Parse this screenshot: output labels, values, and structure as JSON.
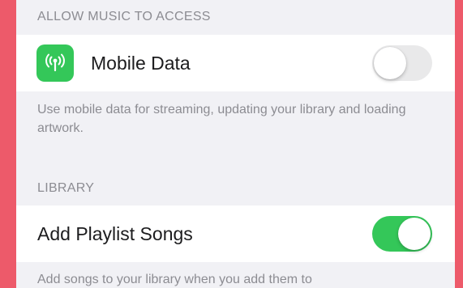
{
  "sections": {
    "access": {
      "header": "ALLOW MUSIC TO ACCESS",
      "row": {
        "label": "Mobile Data",
        "icon": "antenna-icon",
        "icon_color": "#34c759",
        "toggle_on": false
      },
      "footer": "Use mobile data for streaming, updating your library and loading artwork."
    },
    "library": {
      "header": "LIBRARY",
      "row": {
        "label": "Add Playlist Songs",
        "toggle_on": true,
        "toggle_color": "#34c759"
      },
      "footer": "Add songs to your library when you add them to"
    }
  }
}
